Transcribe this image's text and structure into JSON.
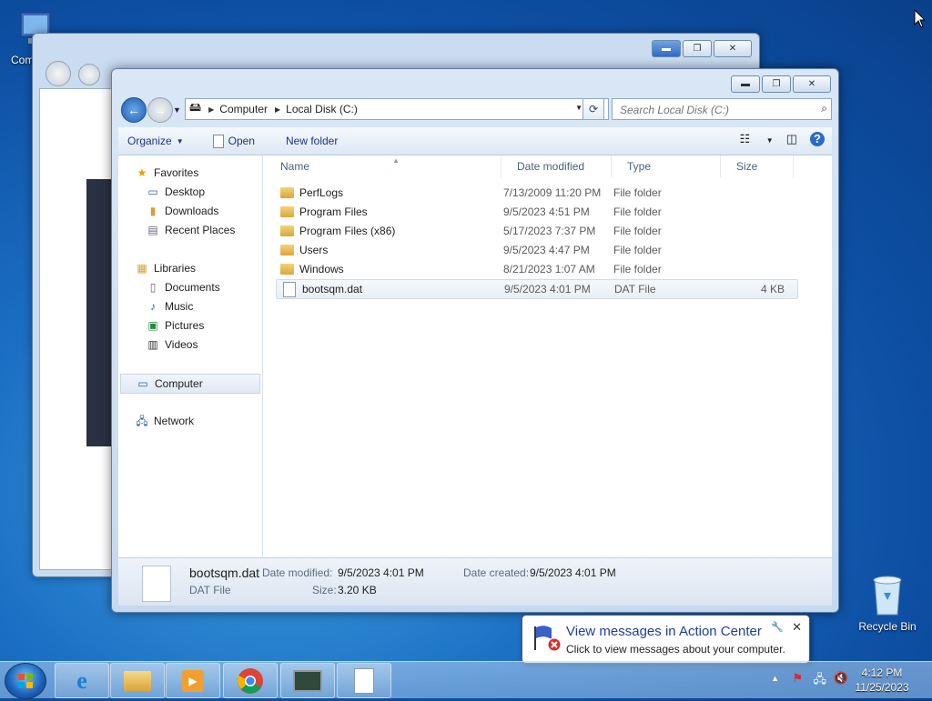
{
  "desktop": {
    "computer_label": "Com",
    "recycle_label": "Recycle Bin"
  },
  "explorer": {
    "breadcrumb": [
      "Computer",
      "Local Disk (C:)"
    ],
    "search_placeholder": "Search Local Disk (C:)",
    "toolbar": {
      "organize": "Organize",
      "open": "Open",
      "new_folder": "New folder"
    },
    "nav": {
      "favorites": "Favorites",
      "desktop": "Desktop",
      "downloads": "Downloads",
      "recent_places": "Recent Places",
      "libraries": "Libraries",
      "documents": "Documents",
      "music": "Music",
      "pictures": "Pictures",
      "videos": "Videos",
      "computer": "Computer",
      "network": "Network"
    },
    "columns": {
      "name": "Name",
      "date": "Date modified",
      "type": "Type",
      "size": "Size"
    },
    "files": [
      {
        "name": "PerfLogs",
        "date": "7/13/2009 11:20 PM",
        "type": "File folder",
        "size": "",
        "kind": "folder"
      },
      {
        "name": "Program Files",
        "date": "9/5/2023 4:51 PM",
        "type": "File folder",
        "size": "",
        "kind": "folder"
      },
      {
        "name": "Program Files (x86)",
        "date": "5/17/2023 7:37 PM",
        "type": "File folder",
        "size": "",
        "kind": "folder"
      },
      {
        "name": "Users",
        "date": "9/5/2023 4:47 PM",
        "type": "File folder",
        "size": "",
        "kind": "folder"
      },
      {
        "name": "Windows",
        "date": "8/21/2023 1:07 AM",
        "type": "File folder",
        "size": "",
        "kind": "folder"
      },
      {
        "name": "bootsqm.dat",
        "date": "9/5/2023 4:01 PM",
        "type": "DAT File",
        "size": "4 KB",
        "kind": "file"
      }
    ],
    "details": {
      "filename": "bootsqm.dat",
      "filetype": "DAT File",
      "date_modified_label": "Date modified:",
      "date_modified": "9/5/2023 4:01 PM",
      "date_created_label": "Date created:",
      "date_created": "9/5/2023 4:01 PM",
      "size_label": "Size:",
      "size": "3.20 KB"
    }
  },
  "balloon": {
    "title": "View messages in Action Center",
    "message": "Click to view messages about your computer."
  },
  "clock": {
    "time": "4:12 PM",
    "date": "11/25/2023"
  }
}
